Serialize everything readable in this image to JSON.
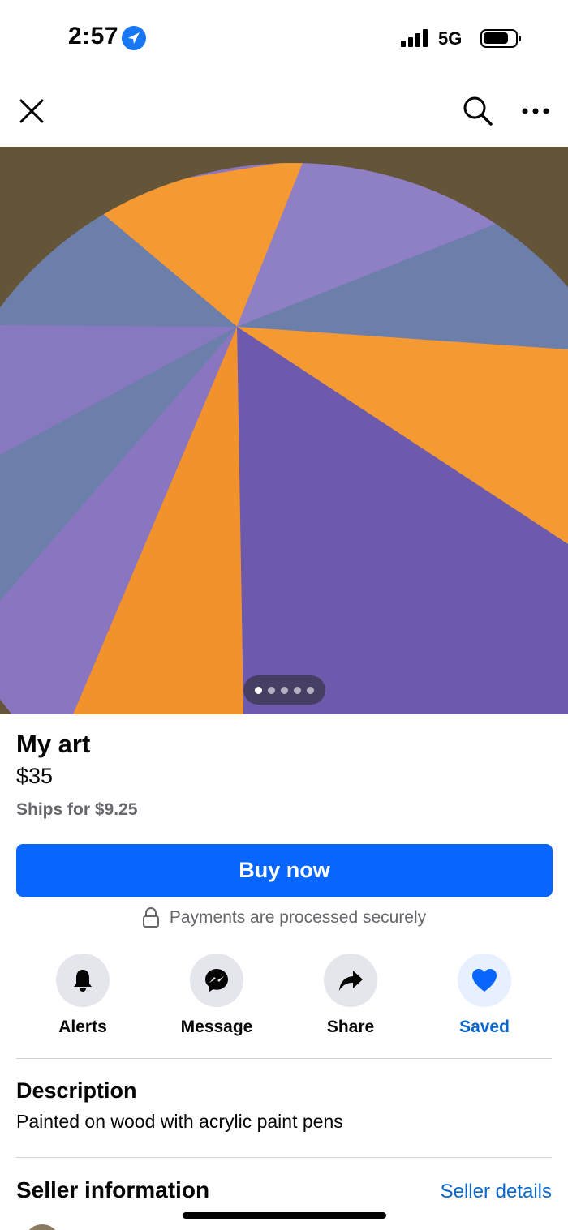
{
  "status_bar": {
    "time": "2:57",
    "network": "5G",
    "signal_bars": 4,
    "battery_level": 0.8
  },
  "top_nav": {
    "close_icon": "close-icon",
    "search_icon": "search-icon",
    "more_icon": "more-icon"
  },
  "photo": {
    "page_count": 5,
    "active_page": 1,
    "colors": {
      "orange": "#f59a32",
      "purple": "#8a76c0",
      "slate": "#6c7fab",
      "wood": "#5a4a30"
    }
  },
  "product": {
    "title": "My art",
    "price": "$35",
    "shipping": "Ships for $9.25"
  },
  "buy_button": {
    "label": "Buy now",
    "color": "#0866ff"
  },
  "secure_note": {
    "text": "Payments are processed securely",
    "icon": "lock-icon"
  },
  "actions": [
    {
      "label": "Alerts",
      "icon": "bell-icon"
    },
    {
      "label": "Message",
      "icon": "messenger-icon"
    },
    {
      "label": "Share",
      "icon": "share-arrow-icon"
    },
    {
      "label": "Saved",
      "icon": "heart-icon",
      "active": true
    }
  ],
  "description": {
    "heading": "Description",
    "text": "Painted on wood with acrylic paint pens"
  },
  "seller": {
    "heading": "Seller information",
    "link": "Seller details"
  }
}
